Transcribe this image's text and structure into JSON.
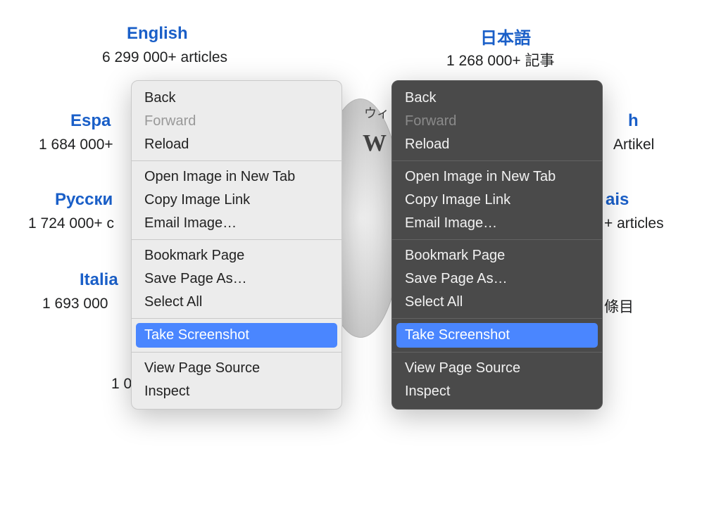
{
  "languages": {
    "english": {
      "title": "English",
      "sub": "6 299 000+ articles"
    },
    "japanese": {
      "title": "日本語",
      "sub": "1 268 000+ 記事"
    },
    "spanish": {
      "title": "Espa",
      "sub": "1 684 000+"
    },
    "german": {
      "title_fragment": "h",
      "sub": "Artikel"
    },
    "russian": {
      "title": "Русски",
      "sub": "1 724 000+ с"
    },
    "french": {
      "title_fragment": "ais",
      "sub": "+ articles"
    },
    "italian": {
      "title": "Italia",
      "sub": "1 693 000"
    },
    "chinese": {
      "sub": "條目"
    },
    "portuguese": {
      "sub": "1 0"
    }
  },
  "logo": {
    "glyph1": "ウィ",
    "glyph2": "W"
  },
  "context_menu": {
    "back": "Back",
    "forward": "Forward",
    "reload": "Reload",
    "open_image": "Open Image in New Tab",
    "copy_image_link": "Copy Image Link",
    "email_image": "Email Image…",
    "bookmark": "Bookmark Page",
    "save_as": "Save Page As…",
    "select_all": "Select All",
    "screenshot": "Take Screenshot",
    "view_source": "View Page Source",
    "inspect": "Inspect"
  }
}
